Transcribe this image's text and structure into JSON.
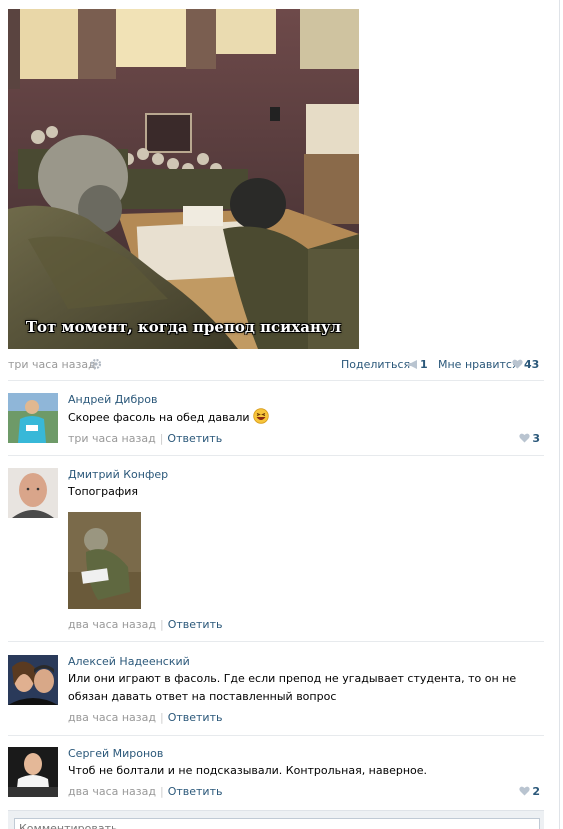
{
  "post": {
    "caption": "Тот момент, когда препод психанул",
    "time": "три часа назад",
    "share_label": "Поделиться",
    "share_count": "1",
    "like_label": "Мне нравится",
    "like_count": "43"
  },
  "comments": [
    {
      "author": "Андрей Дибров",
      "text": "Скорее фасоль на обед давали",
      "time": "три часа назад",
      "reply": "Ответить",
      "likes": "3"
    },
    {
      "author": "Дмитрий Конфер",
      "text": "Топография",
      "time": "два часа назад",
      "reply": "Ответить"
    },
    {
      "author": "Алексей Надеенский",
      "text": "Или они играют в фасоль. Где если препод не угадывает студента, то он не обязан давать ответ на поставленный вопрос",
      "time": "два часа назад",
      "reply": "Ответить"
    },
    {
      "author": "Сергей Миронов",
      "text": "Чтоб не болтали и не подсказывали. Контрольная, наверное.",
      "time": "два часа назад",
      "reply": "Ответить",
      "likes": "2"
    }
  ],
  "comment_box": {
    "placeholder": "Комментировать..."
  },
  "colors": {
    "link": "#2b587a",
    "muted": "#999999",
    "separator": "#e7eaed"
  }
}
